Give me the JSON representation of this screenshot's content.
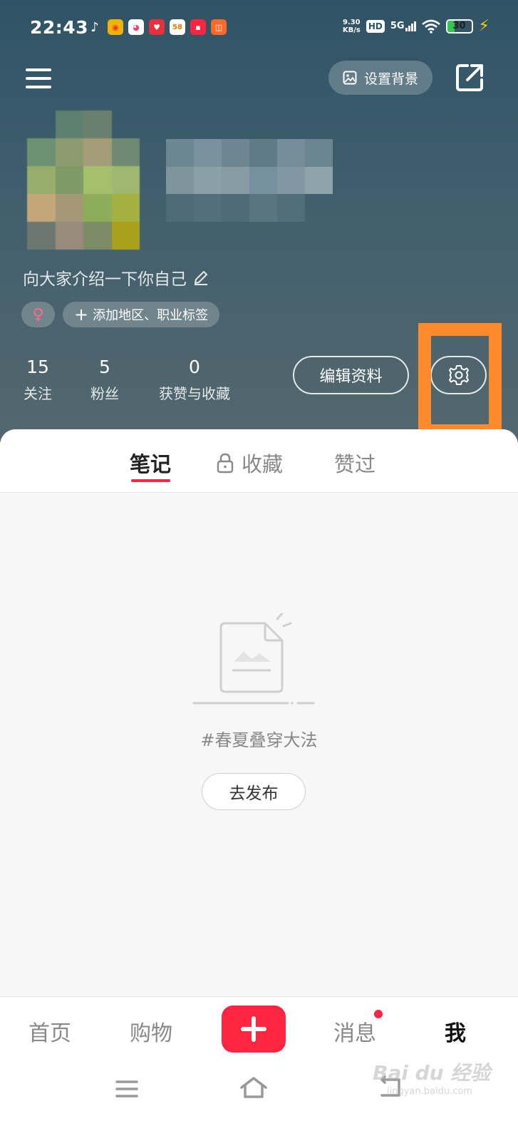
{
  "status_bar": {
    "time": "22:43",
    "net_speed_value": "9.30",
    "net_speed_unit": "KB/s",
    "hd_label": "HD",
    "signal_label": "5G",
    "battery_level": "30",
    "app_icons": [
      {
        "icon": "tiktok-icon",
        "color": "transparent",
        "text": "♪"
      },
      {
        "icon": "weibo-icon",
        "color": "#f0b400",
        "text": "◉"
      },
      {
        "icon": "app-pink-icon",
        "color": "#ffffff",
        "text": "◕"
      },
      {
        "icon": "heart-app-icon",
        "color": "#e8303a",
        "text": "♥"
      },
      {
        "icon": "app-58-icon",
        "color": "#ffffff",
        "text": "58"
      },
      {
        "icon": "xiaohongshu-icon",
        "color": "#ff2442",
        "text": "▪"
      },
      {
        "icon": "app-orange-icon",
        "color": "#ff6a2a",
        "text": "◫"
      }
    ]
  },
  "header": {
    "set_background_label": "设置背景",
    "bio_placeholder": "向大家介绍一下你自己",
    "gender_symbol": "♀",
    "add_tags_label": "添加地区、职业标签",
    "stats": [
      {
        "value": "15",
        "label": "关注"
      },
      {
        "value": "5",
        "label": "粉丝"
      },
      {
        "value": "0",
        "label": "获赞与收藏"
      }
    ],
    "edit_profile_label": "编辑资料"
  },
  "tabs": [
    {
      "label": "笔记",
      "active": true
    },
    {
      "label": "收藏",
      "active": false,
      "icon": "lock-icon"
    },
    {
      "label": "赞过",
      "active": false
    }
  ],
  "empty_state": {
    "hint": "#春夏叠穿大法",
    "publish_label": "去发布"
  },
  "bottom_nav": {
    "items": [
      {
        "label": "首页",
        "active": false
      },
      {
        "label": "购物",
        "active": false
      },
      {
        "label": "消息",
        "active": false,
        "badge": true
      },
      {
        "label": "我",
        "active": true
      }
    ]
  },
  "watermark": {
    "brand": "Bai du 经验",
    "url": "jingyan.baidu.com"
  },
  "colors": {
    "accent": "#ff2442",
    "highlight": "#ff8a2b",
    "header_bg": "#3f5e6d"
  }
}
